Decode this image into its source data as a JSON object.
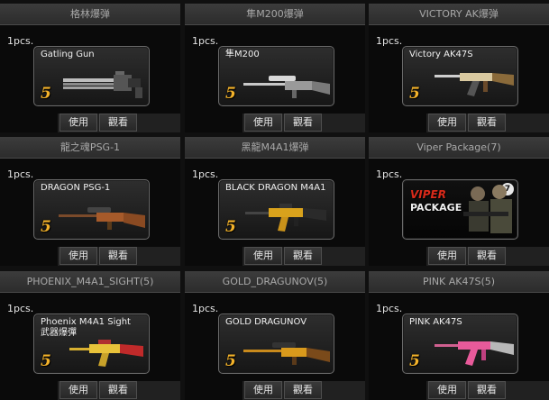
{
  "items": [
    {
      "header": "格林爆弹",
      "qty": "1pcs.",
      "name": "Gatling Gun",
      "sub": "",
      "grade": "5",
      "use": "使用",
      "view": "觀看",
      "weapon_color": "#bdbdbd",
      "weapon_icon": "gatling-gun-icon"
    },
    {
      "header": "隼M200爆弹",
      "qty": "1pcs.",
      "name": "隼M200",
      "sub": "",
      "grade": "5",
      "use": "使用",
      "view": "觀看",
      "weapon_color": "#c8c8c8",
      "weapon_icon": "sniper-rifle-icon"
    },
    {
      "header": "VICTORY AK爆弹",
      "qty": "1pcs.",
      "name": "Victory AK47S",
      "sub": "",
      "grade": "5",
      "use": "使用",
      "view": "觀看",
      "weapon_color": "#d9c9a0",
      "weapon_icon": "ak47-icon"
    },
    {
      "header": "龍之魂PSG-1",
      "qty": "1pcs.",
      "name": "DRAGON PSG-1",
      "sub": "",
      "grade": "5",
      "use": "使用",
      "view": "觀看",
      "weapon_color": "#a65a2a",
      "weapon_icon": "sniper-rifle-icon"
    },
    {
      "header": "黑龍M4A1爆弹",
      "qty": "1pcs.",
      "name": "BLACK DRAGON M4A1",
      "sub": "",
      "grade": "5",
      "use": "使用",
      "view": "觀看",
      "weapon_color": "#d9a21c",
      "weapon_icon": "m4a1-icon"
    },
    {
      "header": "Viper Package(7)",
      "qty": "1pcs.",
      "name": "VIPER",
      "sub": "PACKAGE",
      "grade": "",
      "badge": "7",
      "use": "使用",
      "view": "觀看",
      "weapon_color": "#8a7a60",
      "weapon_icon": "soldiers-icon"
    },
    {
      "header": "PHOENIX_M4A1_SIGHT(5)",
      "qty": "1pcs.",
      "name": "Phoenix  M4A1 Sight",
      "sub": "武器爆彈",
      "grade": "5",
      "use": "使用",
      "view": "觀看",
      "weapon_color": "#e8c23a",
      "weapon_icon": "m4a1-icon"
    },
    {
      "header": "GOLD_DRAGUNOV(5)",
      "qty": "1pcs.",
      "name": "GOLD DRAGUNOV",
      "sub": "",
      "grade": "5",
      "use": "使用",
      "view": "觀看",
      "weapon_color": "#d99a1c",
      "weapon_icon": "sniper-rifle-icon"
    },
    {
      "header": "PINK AK47S(5)",
      "qty": "1pcs.",
      "name": "PINK  AK47S",
      "sub": "",
      "grade": "5",
      "use": "使用",
      "view": "觀看",
      "weapon_color": "#e85a9a",
      "weapon_icon": "ak47-icon"
    }
  ]
}
